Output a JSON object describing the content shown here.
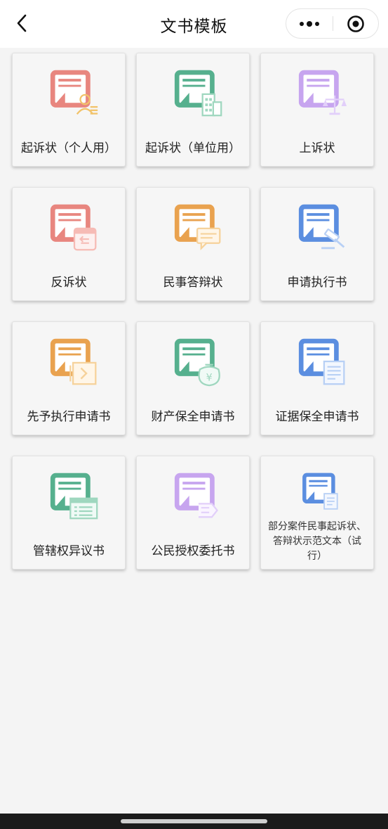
{
  "header": {
    "title": "文书模板",
    "back_icon": "chevron-left-icon",
    "more_icon": "more-dots-icon",
    "close_icon": "target-circle-icon"
  },
  "templates": [
    {
      "label": "起诉状（个人用）",
      "icon": "complaint-individual-icon",
      "color": "#e8867f",
      "accent": "#f2c36a"
    },
    {
      "label": "起诉状（单位用）",
      "icon": "complaint-company-icon",
      "color": "#56b08e",
      "accent": "#9fd7bf"
    },
    {
      "label": "上诉状",
      "icon": "appeal-scale-icon",
      "color": "#c7a5ef",
      "accent": "#e2cffa"
    },
    {
      "label": "反诉状",
      "icon": "counterclaim-calendar-icon",
      "color": "#e8867f",
      "accent": "#f6bbb5"
    },
    {
      "label": "民事答辩状",
      "icon": "defense-chat-icon",
      "color": "#e9a24f",
      "accent": "#f6d29b"
    },
    {
      "label": "申请执行书",
      "icon": "execution-gavel-icon",
      "color": "#5b8ee0",
      "accent": "#b8d0f5"
    },
    {
      "label": "先予执行申请书",
      "icon": "advance-execution-icon",
      "color": "#e9a24f",
      "accent": "#f6d29b"
    },
    {
      "label": "财产保全申请书",
      "icon": "property-preservation-icon",
      "color": "#56b08e",
      "accent": "#9fd7bf"
    },
    {
      "label": "证据保全申请书",
      "icon": "evidence-preservation-icon",
      "color": "#5b8ee0",
      "accent": "#b8d0f5"
    },
    {
      "label": "管辖权异议书",
      "icon": "jurisdiction-objection-icon",
      "color": "#56b08e",
      "accent": "#9fd7bf"
    },
    {
      "label": "公民授权委托书",
      "icon": "power-of-attorney-icon",
      "color": "#c7a5ef",
      "accent": "#e2cffa"
    },
    {
      "label": "部分案件民事起诉状、答辩状示范文本（试行）",
      "icon": "model-text-icon",
      "color": "#5b8ee0",
      "accent": "#b8d0f5"
    }
  ]
}
